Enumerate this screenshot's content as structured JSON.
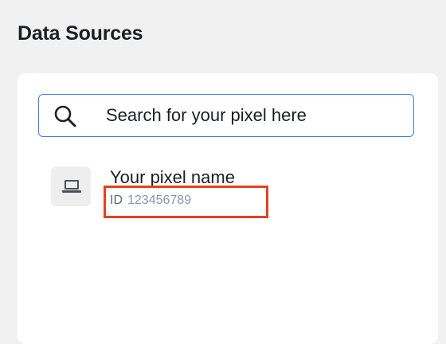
{
  "header": {
    "title": "Data Sources"
  },
  "search": {
    "placeholder": "Search for your pixel here",
    "value": ""
  },
  "pixel": {
    "name": "Your pixel name",
    "id_label": "ID",
    "id_value": "123456789"
  },
  "icons": {
    "search": "search-icon",
    "pixel": "laptop-icon"
  },
  "colors": {
    "search_border": "#3b82e0",
    "highlight": "#e3431f",
    "background": "#f1f1f1"
  }
}
